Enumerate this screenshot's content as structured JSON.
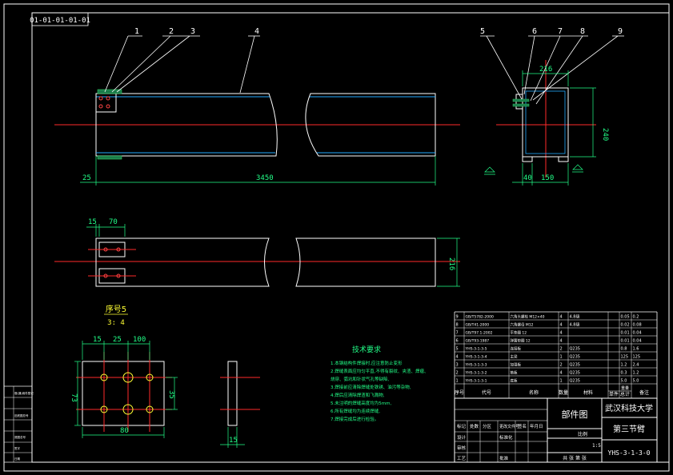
{
  "drawing_code": "01-01-01-01-01",
  "callouts": [
    "1",
    "2",
    "3",
    "4",
    "5",
    "6",
    "7",
    "8",
    "9"
  ],
  "dims": {
    "left_offset": "25",
    "length": "3450",
    "side_width": "216",
    "side_height": "240",
    "side_bottom_a": "40",
    "side_bottom_b": "150",
    "plan_a": "15",
    "plan_b": "70",
    "plan_height": "216",
    "detail_w1": "15",
    "detail_w2": "25",
    "detail_w3": "100",
    "detail_height": "73",
    "detail_inner": "35",
    "detail_width": "80",
    "detail_thick": "15"
  },
  "detail": {
    "title": "序号5",
    "scale": "3: 4"
  },
  "tech": {
    "title": "技术要求",
    "lines": [
      "1.本钢结构件焊接时,应注意防止变形",
      "2.焊缝表面应均匀平直,不得有裂纹、夹渣、焊瘤、",
      "烧穿、弧坑和针状气孔等缺陷,",
      "3.焊接前应清除焊缝处铁锈、油污等杂物,",
      "4.焊后应清除焊渣和飞溅物,",
      "5.未注明的焊缝高度均为5mm,",
      "6.所有焊缝均为连续焊缝,",
      "7.焊接完成后进行检验。"
    ]
  },
  "bom": {
    "rows": [
      [
        "9",
        "GB/T5782-2000",
        "六角头螺栓 M12×40",
        "4",
        "4.8级",
        "",
        "0.05",
        "0.2"
      ],
      [
        "8",
        "GB/T41-2000",
        "六角螺母 M12",
        "4",
        "4.8级",
        "",
        "0.02",
        "0.08"
      ],
      [
        "7",
        "GB/T97.1-2002",
        "平垫圈 12",
        "4",
        "",
        "",
        "0.01",
        "0.04"
      ],
      [
        "6",
        "GB/T93-1987",
        "弹簧垫圈 12",
        "4",
        "",
        "",
        "0.01",
        "0.04"
      ],
      [
        "5",
        "YHS-3-1-3-5",
        "连接板",
        "2",
        "Q235",
        "",
        "0.8",
        "1.6"
      ],
      [
        "4",
        "YHS-3-1-3-4",
        "主梁",
        "1",
        "Q235",
        "",
        "125",
        "125"
      ],
      [
        "3",
        "YHS-3-1-3-3",
        "加强板",
        "2",
        "Q235",
        "",
        "1.2",
        "2.4"
      ],
      [
        "2",
        "YHS-3-1-3-2",
        "筋板",
        "4",
        "Q235",
        "",
        "0.3",
        "1.2"
      ],
      [
        "1",
        "YHS-3-1-3-1",
        "底板",
        "1",
        "Q235",
        "",
        "5.0",
        "5.0"
      ]
    ],
    "header": [
      "序号",
      "代号",
      "名称",
      "数量",
      "材料",
      "单件",
      "总计",
      "备注"
    ],
    "header_weight": "重量"
  },
  "title_block": {
    "part_type": "部件图",
    "university": "武汉科技大学",
    "part_name": "第三节臂",
    "drawing_no": "YHS-3-1-3-0",
    "scale_label": "比例",
    "scale": "1:5",
    "sheet": "共 张 第 张",
    "rows": [
      [
        "标记",
        "处数",
        "分区",
        "更改文件号",
        "签名",
        "年月日"
      ],
      [
        "设计",
        "",
        "标准化",
        "",
        "阶段标记",
        "重量",
        "比例"
      ],
      [
        "审核",
        "",
        "",
        "",
        "",
        "",
        "1:5"
      ],
      [
        "工艺",
        "",
        "批准",
        "",
        "共 张 第 张"
      ]
    ]
  },
  "left_block": [
    "借(通)用件登记",
    "",
    "旧底图总号",
    "",
    "底图总号",
    "签字",
    "日期"
  ]
}
